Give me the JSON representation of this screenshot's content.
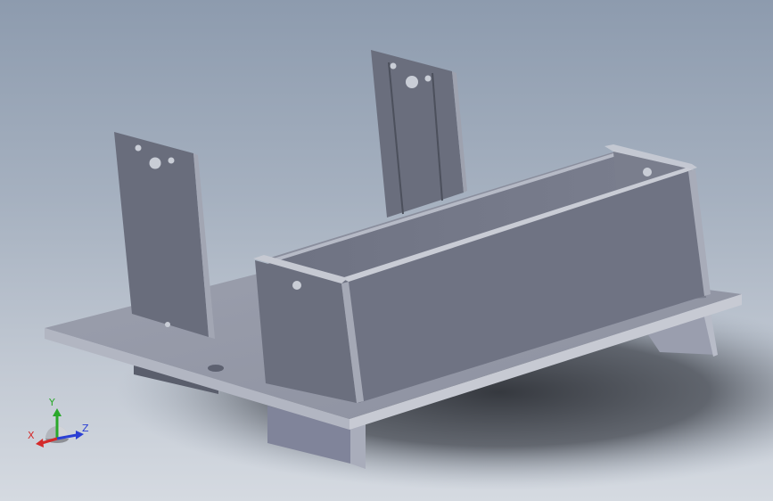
{
  "triad": {
    "x_label": "X",
    "y_label": "Y",
    "z_label": "Z",
    "colors": {
      "x": "#d42a2a",
      "y": "#2aa82a",
      "z": "#2a3fd4"
    }
  },
  "model": {
    "part_color": "#7d8292",
    "shadow_color": "#3a3d44"
  }
}
